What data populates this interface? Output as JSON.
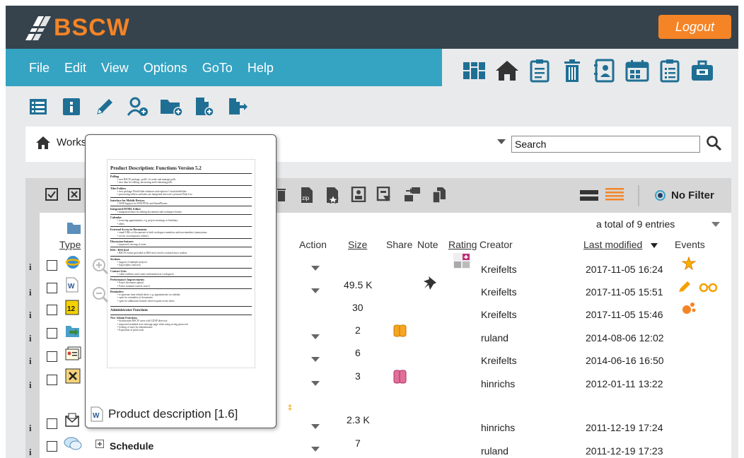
{
  "header": {
    "logo_text": "BSCW",
    "logout_label": "Logout"
  },
  "menu": [
    "File",
    "Edit",
    "View",
    "Options",
    "GoTo",
    "Help"
  ],
  "breadcrumb": {
    "label": "Works"
  },
  "search": {
    "value": "Search"
  },
  "filter": {
    "label": "No Filter"
  },
  "list": {
    "entries_text": "a total of 9 entries",
    "headers": {
      "type": "Type",
      "action": "Action",
      "size": "Size",
      "share": "Share",
      "note": "Note",
      "rating": "Rating",
      "creator": "Creator",
      "last_modified": "Last modified",
      "events": "Events"
    },
    "rows": [
      {
        "info": "i",
        "size": "",
        "creator": "Kreifelts",
        "modified": "2017-11-05 16:24"
      },
      {
        "info": "i",
        "size": "49.5 K",
        "creator": "Kreifelts",
        "modified": "2017-11-05 15:51"
      },
      {
        "info": "i",
        "size": "30",
        "creator": "Kreifelts",
        "modified": "2017-11-05 15:46"
      },
      {
        "info": "i",
        "size": "2",
        "creator": "ruland",
        "modified": "2014-08-06 12:02"
      },
      {
        "info": "i",
        "size": "6",
        "creator": "Kreifelts",
        "modified": "2014-06-16 16:50"
      },
      {
        "info": "i",
        "size": "3",
        "creator": "hinrichs",
        "modified": "2012-01-11 13:22"
      },
      {
        "info": "i",
        "size": "2.3 K",
        "creator": "hinrichs",
        "modified": "2011-12-19 17:24"
      },
      {
        "info": "i",
        "name": "Schedule",
        "size": "7",
        "creator": "ruland",
        "modified": "2011-12-19 17:23"
      }
    ]
  },
  "popup": {
    "caption": "Product description [1.6]",
    "doc_title": "Product Description: Functions Version 5.2",
    "sections": [
      {
        "h": "Polling",
        "items": [
          "new BSCW package „polls“ to create and manage polls",
          "new data for editing, answering and evaluating polls"
        ]
      },
      {
        "h": "Tiler Folders",
        "items": [
          "new package FlowFolder enhances and replaces CirculationFolder",
          "processing folders and tasks are integrated into user's personal Task List"
        ]
      },
      {
        "h": "Interface for Mobile Devices",
        "items": [
          "WAP Support for WAP PDAs and SmartPhones"
        ]
      },
      {
        "h": "Integrated HTML Editor",
        "items": [
          "integrated editor for editing documents and workspace homes"
        ]
      },
      {
        "h": "Calendar",
        "items": [
          "recurring appointments, e.g. project meetings or birthdays",
          "alerts"
        ]
      },
      {
        "h": "External Access to Documents",
        "items": [
          "email URLs of documents to both workspace members and non-members (anonymous",
          "access via temporary tokens)"
        ]
      },
      {
        "h": "Discussion features",
        "items": [
          "improved viewing of notes"
        ]
      },
      {
        "h": "RSS / RSS feed",
        "items": [
          "BSCW events provided as RSS news feed to external news readers"
        ]
      },
      {
        "h": "Sections",
        "items": [
          "support of multiple projects",
          "logo/subject function"
        ]
      },
      {
        "h": "Contact Lists",
        "items": [
          "collect address and contact information in workspaces"
        ]
      },
      {
        "h": "Performance Improvements",
        "items": [
          "Faster document upload",
          "Faster standard context search"
        ]
      },
      {
        "h": "Reminders",
        "items": [
          "to generate time related alerts, e.g. appointments in calendar",
          "open for reminders of documents",
          "open for additional features which require active alerts"
        ]
      }
    ],
    "admin_title": "Administrator Functions",
    "admin_sections": [
      {
        "h": "New Admin Functions",
        "items": [
          "Synchronize BSCW users with LDAP directory",
          "improved standard error message page when using wrong password",
          "locking of users by administrator",
          "Expiration of passwords"
        ]
      }
    ]
  },
  "colors": {
    "orange": "#f58426",
    "teal": "#35a3c2",
    "dark": "#36434c",
    "icon_blue": "#1f6f95"
  }
}
